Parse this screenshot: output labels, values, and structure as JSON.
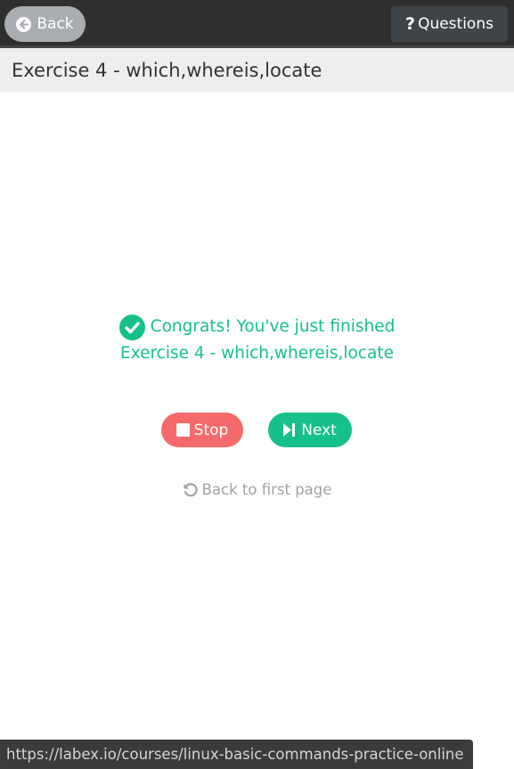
{
  "header": {
    "back_label": "Back",
    "questions_label": "Questions",
    "questions_icon": "?"
  },
  "exercise": {
    "title": "Exercise 4 - which,whereis,locate"
  },
  "result": {
    "congrats_line1": "Congrats! You've just finished",
    "congrats_line2": "Exercise 4 - which,whereis,locate",
    "stop_label": "Stop",
    "next_label": "Next",
    "back_first_label": "Back to first page"
  },
  "status_bar": {
    "url": "https://labex.io/courses/linux-basic-commands-practice-online"
  },
  "icons": {
    "back": "arrow-circle-left-icon",
    "questions": "question-mark-icon",
    "check": "check-circle-icon",
    "stop": "stop-square-icon",
    "next": "step-forward-icon",
    "undo": "undo-icon"
  },
  "colors": {
    "accent_green": "#16c08a",
    "stop_red": "#f56b6b",
    "topbar": "#2f2f2f",
    "back_button": "#a9adb1",
    "questions_button": "#3f4449",
    "title_bar": "#eceeef",
    "muted_text": "#a2a2a2"
  }
}
